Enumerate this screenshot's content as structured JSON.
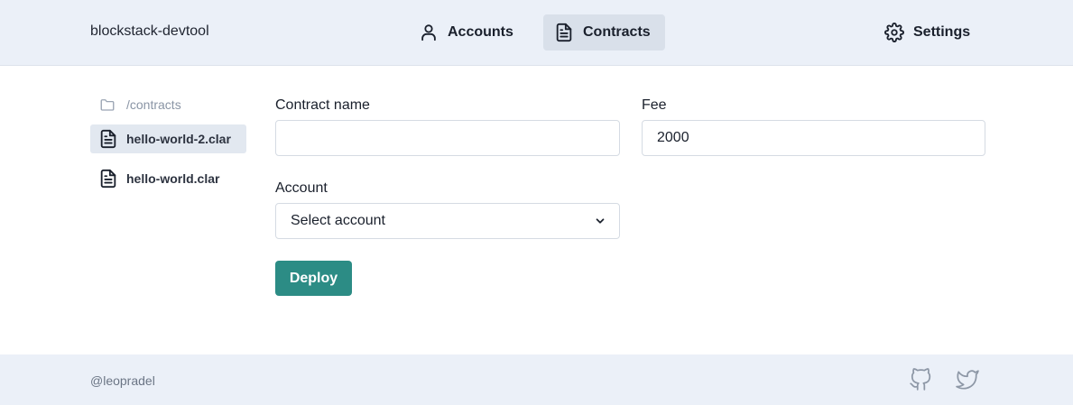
{
  "header": {
    "brand": "blockstack-devtool",
    "nav": {
      "accounts": "Accounts",
      "contracts": "Contracts",
      "settings": "Settings"
    }
  },
  "sidebar": {
    "root": "/contracts",
    "files": [
      "hello-world-2.clar",
      "hello-world.clar"
    ]
  },
  "form": {
    "contract_name_label": "Contract name",
    "contract_name_value": "",
    "fee_label": "Fee",
    "fee_value": "2000",
    "account_label": "Account",
    "account_selected": "Select account",
    "deploy_label": "Deploy"
  },
  "footer": {
    "user": "@leopradel"
  },
  "colors": {
    "header_bg": "#ebf0f8",
    "accent": "#2c8c85"
  },
  "icons": {
    "accounts": "user-icon",
    "contracts": "document-icon",
    "settings": "gear-icon",
    "folder": "folder-icon",
    "github": "github-icon",
    "twitter": "twitter-icon"
  }
}
